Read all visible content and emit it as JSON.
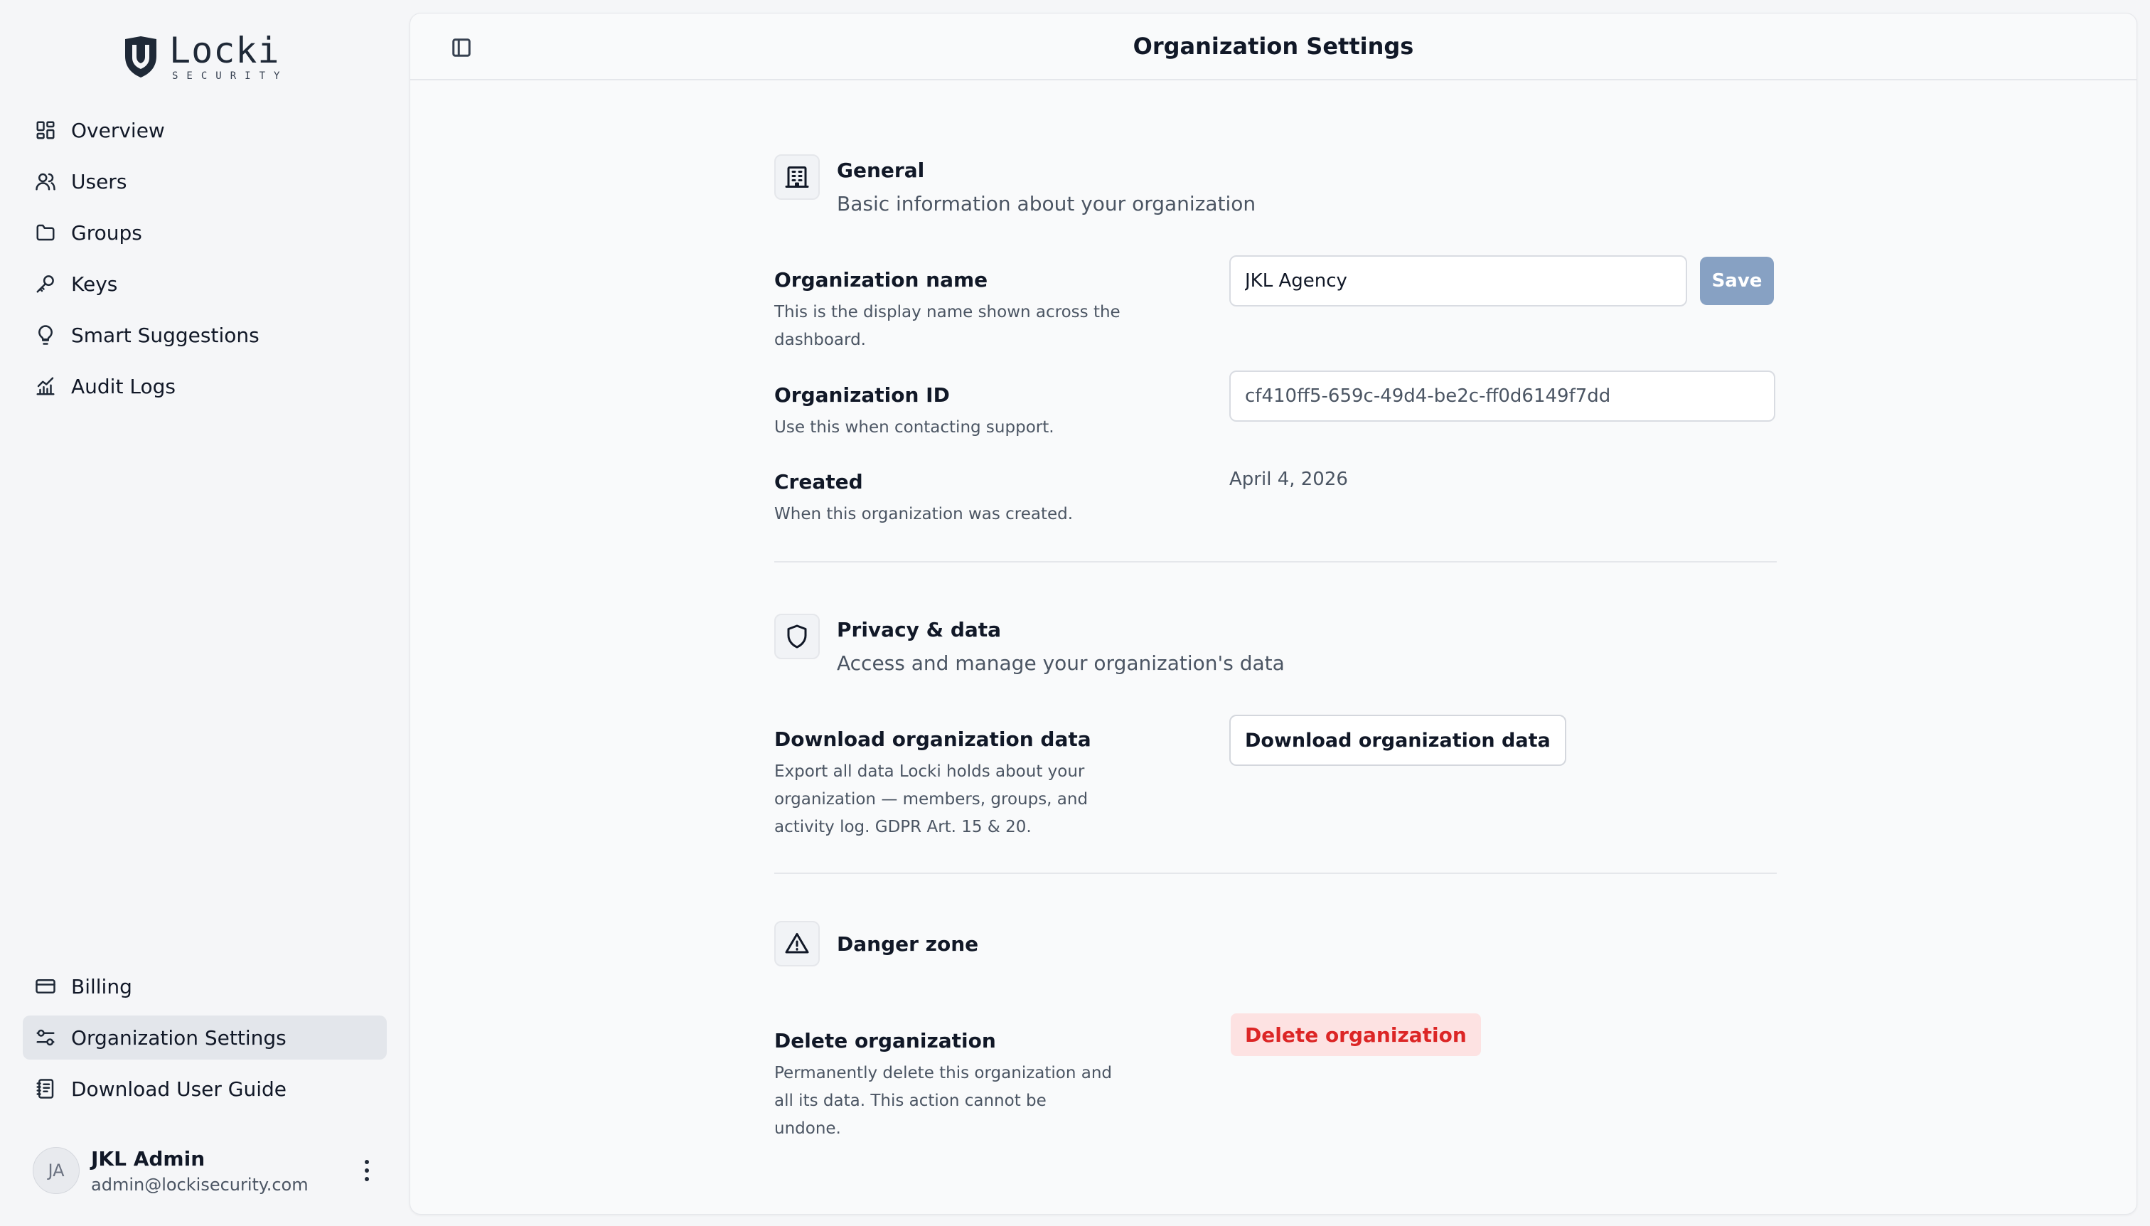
{
  "brand": {
    "name": "Locki",
    "tagline": "SECURITY"
  },
  "sidebar": {
    "items": [
      {
        "label": "Overview",
        "icon": "dashboard-grid-icon"
      },
      {
        "label": "Users",
        "icon": "users-icon"
      },
      {
        "label": "Groups",
        "icon": "folder-icon"
      },
      {
        "label": "Keys",
        "icon": "key-icon"
      },
      {
        "label": "Smart Suggestions",
        "icon": "lightbulb-icon"
      },
      {
        "label": "Audit Logs",
        "icon": "chart-icon"
      }
    ],
    "bottom_items": [
      {
        "label": "Billing",
        "icon": "credit-card-icon"
      },
      {
        "label": "Organization Settings",
        "icon": "sliders-icon",
        "active": true
      },
      {
        "label": "Download User Guide",
        "icon": "book-icon"
      }
    ],
    "user": {
      "initials": "JA",
      "name": "JKL Admin",
      "email": "admin@lockisecurity.com"
    }
  },
  "header": {
    "title": "Organization Settings"
  },
  "general": {
    "title": "General",
    "subtitle": "Basic information about your organization",
    "org_name": {
      "label": "Organization name",
      "description": "This is the display name shown across the dashboard.",
      "value": "JKL Agency",
      "save_label": "Save"
    },
    "org_id": {
      "label": "Organization ID",
      "description": "Use this when contacting support.",
      "value": "cf410ff5-659c-49d4-be2c-ff0d6149f7dd"
    },
    "created": {
      "label": "Created",
      "description": "When this organization was created.",
      "value": "April 4, 2026"
    }
  },
  "privacy": {
    "title": "Privacy & data",
    "subtitle": "Access and manage your organization's data",
    "download": {
      "label": "Download organization data",
      "description": "Export all data Locki holds about your organization — members, groups, and activity log. GDPR Art. 15 & 20.",
      "button_label": "Download organization data"
    }
  },
  "danger": {
    "title": "Danger zone",
    "delete": {
      "label": "Delete organization",
      "description": "Permanently delete this organization and all its data. This action cannot be undone.",
      "button_label": "Delete organization"
    }
  },
  "colors": {
    "save_button": "#87a1c3",
    "danger_text": "#dc2626",
    "danger_bg": "#fde2e2",
    "active_nav": "#e3e6eb"
  }
}
